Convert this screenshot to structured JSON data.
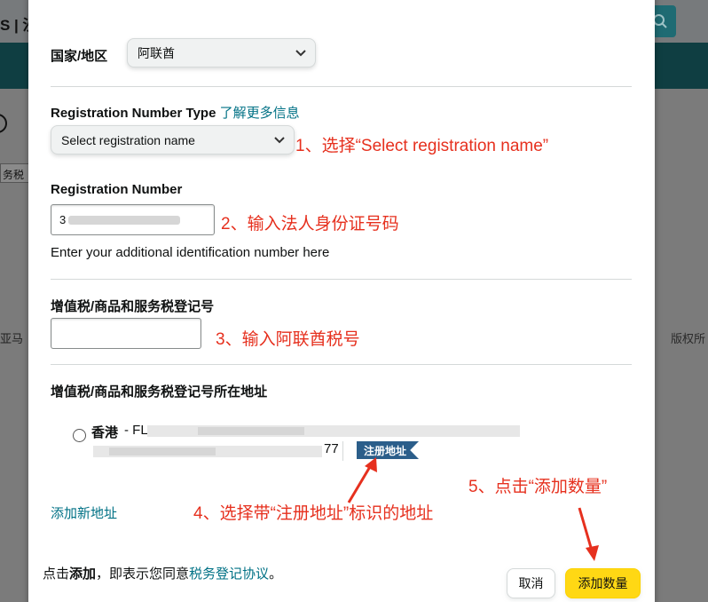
{
  "background": {
    "logo_text": "S | 沙",
    "tab_text": "务税",
    "left_text": "亚马",
    "right_text": "版权所"
  },
  "form": {
    "country_label": "国家/地区",
    "country_value": "阿联酋",
    "reg_type_label": "Registration Number Type",
    "learn_more_link": "了解更多信息",
    "reg_type_placeholder": "Select registration name",
    "reg_number_label": "Registration Number",
    "reg_number_value": "3",
    "reg_number_helper": "Enter your additional identification number here",
    "vat_label": "增值税/商品和服务税登记号",
    "vat_value": "",
    "vat_address_label": "增值税/商品和服务税登记号所在地址",
    "address_region": "香港",
    "address_line1_prefix": "- FL",
    "address_line2_suffix": "77",
    "registered_badge": "注册地址",
    "add_address_link": "添加新地址"
  },
  "footer": {
    "consent_prefix": "点击",
    "consent_bold": "添加",
    "consent_middle": "，即表示您同意",
    "consent_link": "税务登记协议",
    "consent_suffix": "。",
    "cancel_button": "取消",
    "add_button": "添加数量"
  },
  "annotations": {
    "step1": "1、选择“Select registration name”",
    "step2": "2、输入法人身份证号码",
    "step3": "3、输入阿联酋税号",
    "step4": "4、选择带“注册地址”标识的地址",
    "step5": "5、点击“添加数量”"
  },
  "colors": {
    "annotation_red": "#e6301e",
    "link_teal": "#007185",
    "badge_blue": "#2b5e8a",
    "primary_yellow": "#ffd814",
    "nav_dark": "#0f3e42"
  }
}
